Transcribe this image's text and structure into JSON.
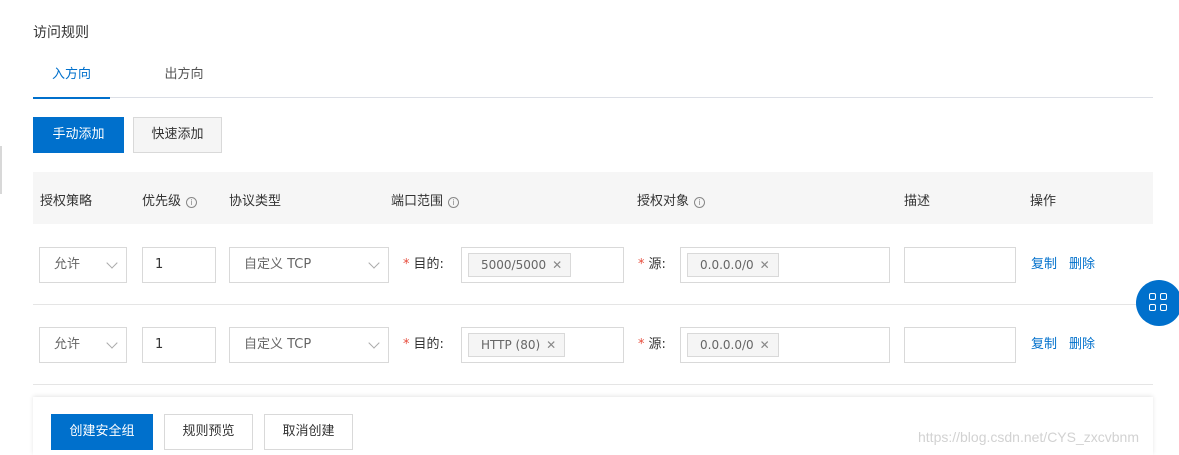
{
  "section_title": "访问规则",
  "tabs": [
    {
      "label": "入方向",
      "active": true
    },
    {
      "label": "出方向",
      "active": false
    }
  ],
  "add_buttons": {
    "manual": "手动添加",
    "quick": "快速添加"
  },
  "table": {
    "headers": {
      "policy": "授权策略",
      "priority": "优先级",
      "protocol": "协议类型",
      "port_range": "端口范围",
      "auth_object": "授权对象",
      "description": "描述",
      "actions": "操作"
    },
    "info_icon": "ⓘ",
    "rows": [
      {
        "policy": "允许",
        "priority": "1",
        "protocol": "自定义 TCP",
        "port_label": "目的:",
        "port_tag": "5000/5000",
        "source_label": "源:",
        "source_tag": "0.0.0.0/0",
        "description": "",
        "copy": "复制",
        "delete": "删除"
      },
      {
        "policy": "允许",
        "priority": "1",
        "protocol": "自定义 TCP",
        "port_label": "目的:",
        "port_tag": "HTTP (80)",
        "source_label": "源:",
        "source_tag": "0.0.0.0/0",
        "description": "",
        "copy": "复制",
        "delete": "删除"
      }
    ]
  },
  "footer": {
    "create": "创建安全组",
    "preview": "规则预览",
    "cancel": "取消创建"
  },
  "watermark": "https://blog.csdn.net/CYS_zxcvbnm",
  "colors": {
    "primary": "#0070cc",
    "required": "#e74c3c",
    "header_bg": "#f6f6f6"
  }
}
